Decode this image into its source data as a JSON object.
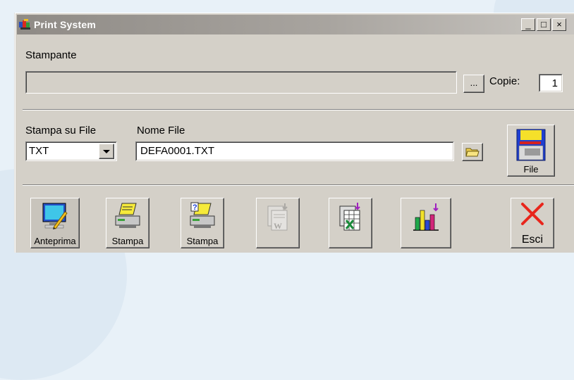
{
  "window": {
    "title": "Print System",
    "minimize": "_",
    "maximize": "□",
    "close": "×"
  },
  "printer": {
    "label": "Stampante",
    "value": "",
    "browse_label": "...",
    "copies_label": "Copie:",
    "copies_value": "1"
  },
  "file": {
    "print_to_file_label": "Stampa su File",
    "format_value": "TXT",
    "filename_label": "Nome File",
    "filename_value": "DEFA0001.TXT",
    "save_label": "File"
  },
  "toolbar": {
    "preview_label": "Anteprima",
    "print_label": "Stampa",
    "print_dialog_label": "Stampa",
    "exit_label": "Esci"
  },
  "colors": {
    "titlebar": "#8f8b86",
    "face": "#d4d0c8",
    "exit_x": "#e8261c"
  }
}
